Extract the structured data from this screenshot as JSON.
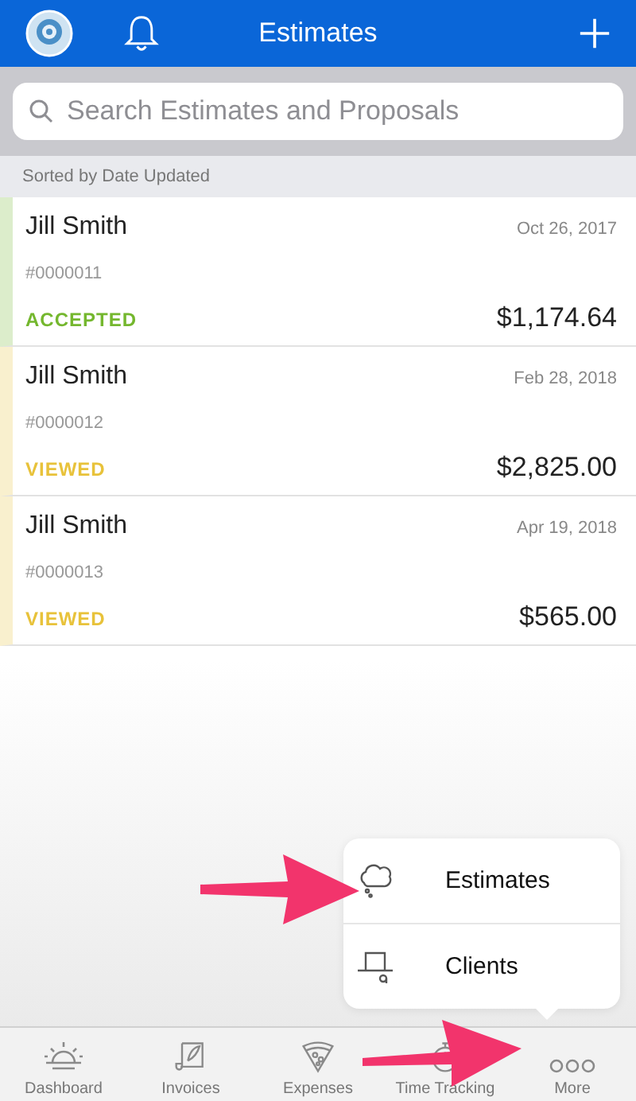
{
  "header": {
    "title": "Estimates"
  },
  "search": {
    "placeholder": "Search Estimates and Proposals"
  },
  "list_header": "Sorted by Date Updated",
  "estimates": [
    {
      "client": "Jill Smith",
      "date": "Oct 26, 2017",
      "number": "#0000011",
      "status": "ACCEPTED",
      "color": "#74b72e",
      "amount": "$1,174.64"
    },
    {
      "client": "Jill Smith",
      "date": "Feb 28, 2018",
      "number": "#0000012",
      "status": "VIEWED",
      "color": "#e8c23a",
      "amount": "$2,825.00"
    },
    {
      "client": "Jill Smith",
      "date": "Apr 19, 2018",
      "number": "#0000013",
      "status": "VIEWED",
      "color": "#e8c23a",
      "amount": "$565.00"
    }
  ],
  "more_menu": [
    {
      "kind": "estimates",
      "label": "Estimates"
    },
    {
      "kind": "clients",
      "label": "Clients"
    }
  ],
  "tab_bar": [
    {
      "kind": "dashboard",
      "label": "Dashboard"
    },
    {
      "kind": "invoices",
      "label": "Invoices"
    },
    {
      "kind": "expenses",
      "label": "Expenses"
    },
    {
      "kind": "time",
      "label": "Time Tracking"
    },
    {
      "kind": "more",
      "label": "More"
    }
  ]
}
